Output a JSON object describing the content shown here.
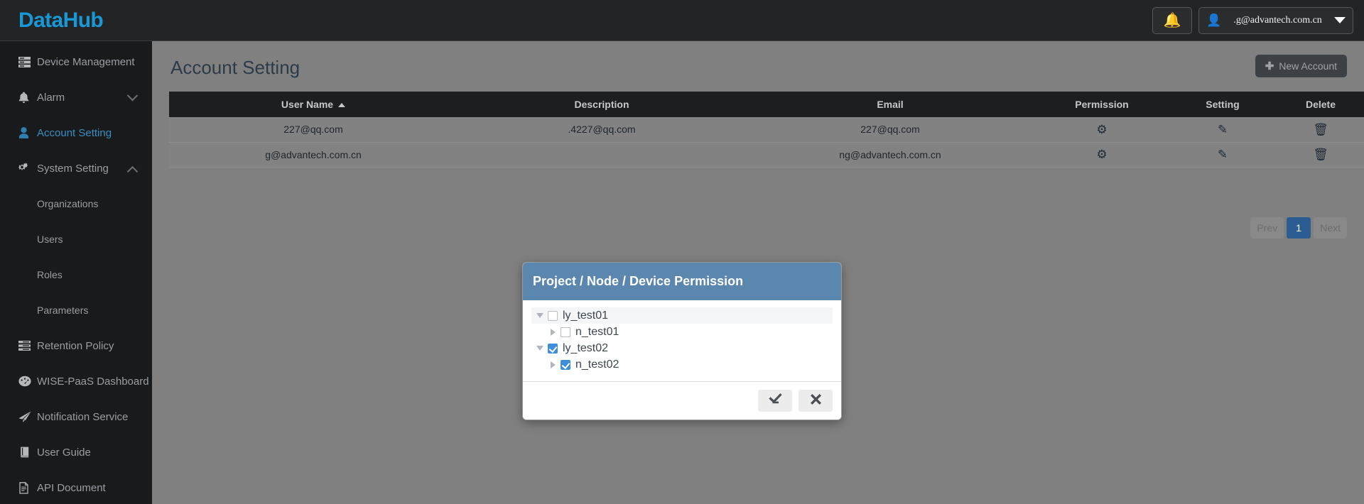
{
  "brand": {
    "name": "DataHub"
  },
  "topbar": {
    "bell_icon": "bell-icon",
    "user_icon": "user-icon",
    "user_email": ".g@advantech.com.cn",
    "caret_icon": "caret-down-icon"
  },
  "sidebar": {
    "items": [
      {
        "label": "Device Management",
        "icon": "server-icon",
        "active": false,
        "sub": false,
        "chevron": ""
      },
      {
        "label": "Alarm",
        "icon": "bell-icon",
        "active": false,
        "sub": false,
        "chevron": "down"
      },
      {
        "label": "Account Setting",
        "icon": "user-icon",
        "active": true,
        "sub": false,
        "chevron": ""
      },
      {
        "label": "System Setting",
        "icon": "gears-icon",
        "active": false,
        "sub": false,
        "chevron": "up"
      },
      {
        "label": "Organizations",
        "icon": "",
        "active": false,
        "sub": true,
        "chevron": ""
      },
      {
        "label": "Users",
        "icon": "",
        "active": false,
        "sub": true,
        "chevron": ""
      },
      {
        "label": "Roles",
        "icon": "",
        "active": false,
        "sub": true,
        "chevron": ""
      },
      {
        "label": "Parameters",
        "icon": "",
        "active": false,
        "sub": true,
        "chevron": ""
      },
      {
        "label": "Retention Policy",
        "icon": "lines-icon",
        "active": false,
        "sub": false,
        "chevron": ""
      },
      {
        "label": "WISE-PaaS Dashboard",
        "icon": "dashboard-icon",
        "active": false,
        "sub": false,
        "chevron": ""
      },
      {
        "label": "Notification Service",
        "icon": "paper-plane-icon",
        "active": false,
        "sub": false,
        "chevron": ""
      },
      {
        "label": "User Guide",
        "icon": "book-icon",
        "active": false,
        "sub": false,
        "chevron": ""
      },
      {
        "label": "API Document",
        "icon": "file-icon",
        "active": false,
        "sub": false,
        "chevron": ""
      }
    ]
  },
  "main": {
    "page_title": "Account Setting",
    "new_account_label": "New Account",
    "new_account_icon": "plus-icon",
    "table": {
      "columns": [
        "User Name",
        "Description",
        "Email",
        "Permission",
        "Setting",
        "Delete"
      ],
      "sorted_column": "User Name",
      "sort_direction": "asc",
      "rows": [
        {
          "user_name": "227@qq.com",
          "description": ".4227@qq.com",
          "email": "227@qq.com",
          "permission_icon": "gear-icon",
          "setting_icon": "pencil-icon",
          "delete_icon": "trash-icon"
        },
        {
          "user_name": "g@advantech.com.cn",
          "description": "",
          "email": "ng@advantech.com.cn",
          "permission_icon": "gear-icon",
          "setting_icon": "pencil-icon",
          "delete_icon": "trash-icon"
        }
      ]
    },
    "pagination": {
      "prev": "Prev",
      "pages": [
        "1"
      ],
      "current": "1",
      "next": "Next"
    }
  },
  "modal": {
    "title": "Project / Node / Device Permission",
    "tree": [
      {
        "label": "ly_test01",
        "level": 1,
        "expanded": true,
        "checked": false,
        "selected": true
      },
      {
        "label": "n_test01",
        "level": 2,
        "expanded": false,
        "checked": false,
        "selected": false
      },
      {
        "label": "ly_test02",
        "level": 1,
        "expanded": true,
        "checked": true,
        "selected": false
      },
      {
        "label": "n_test02",
        "level": 2,
        "expanded": false,
        "checked": true,
        "selected": false
      }
    ],
    "confirm_icon": "save-check-icon",
    "cancel_icon": "close-x-icon"
  },
  "colors": {
    "brand": "#1899d6",
    "modal_header": "#5b86ad",
    "checkbox_on": "#3f8edc",
    "page_current": "#2c5d92",
    "bell": "#f0b323"
  }
}
